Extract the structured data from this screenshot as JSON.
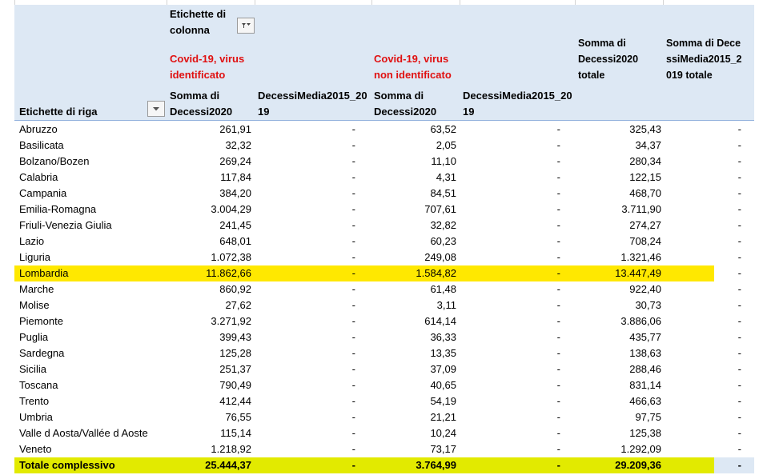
{
  "header": {
    "col_labels": "Etichette di colonna",
    "row_labels": "Etichette di riga",
    "group1": "Covid-19, virus identificato",
    "group2": "Covid-19, virus non identificato",
    "sum2020": "Somma di Decessi2020",
    "media": "DecessiMedia2015_2019",
    "total_sum": "Somma di Decessi2020 totale",
    "total_media": "Somma di DecessiMedia2015_2019 totale"
  },
  "rows": [
    {
      "name": "Abruzzo",
      "v1": "261,91",
      "m1": "-",
      "v2": "63,52",
      "m2": "-",
      "t": "325,43",
      "tm": "-"
    },
    {
      "name": "Basilicata",
      "v1": "32,32",
      "m1": "-",
      "v2": "2,05",
      "m2": "-",
      "t": "34,37",
      "tm": "-"
    },
    {
      "name": "Bolzano/Bozen",
      "v1": "269,24",
      "m1": "-",
      "v2": "11,10",
      "m2": "-",
      "t": "280,34",
      "tm": "-"
    },
    {
      "name": "Calabria",
      "v1": "117,84",
      "m1": "-",
      "v2": "4,31",
      "m2": "-",
      "t": "122,15",
      "tm": "-"
    },
    {
      "name": "Campania",
      "v1": "384,20",
      "m1": "-",
      "v2": "84,51",
      "m2": "-",
      "t": "468,70",
      "tm": "-"
    },
    {
      "name": "Emilia-Romagna",
      "v1": "3.004,29",
      "m1": "-",
      "v2": "707,61",
      "m2": "-",
      "t": "3.711,90",
      "tm": "-"
    },
    {
      "name": "Friuli-Venezia Giulia",
      "v1": "241,45",
      "m1": "-",
      "v2": "32,82",
      "m2": "-",
      "t": "274,27",
      "tm": "-"
    },
    {
      "name": "Lazio",
      "v1": "648,01",
      "m1": "-",
      "v2": "60,23",
      "m2": "-",
      "t": "708,24",
      "tm": "-"
    },
    {
      "name": "Liguria",
      "v1": "1.072,38",
      "m1": "-",
      "v2": "249,08",
      "m2": "-",
      "t": "1.321,46",
      "tm": "-"
    },
    {
      "name": "Lombardia",
      "v1": "11.862,66",
      "m1": "-",
      "v2": "1.584,82",
      "m2": "-",
      "t": "13.447,49",
      "tm": "-",
      "highlight": true
    },
    {
      "name": "Marche",
      "v1": "860,92",
      "m1": "-",
      "v2": "61,48",
      "m2": "-",
      "t": "922,40",
      "tm": "-"
    },
    {
      "name": "Molise",
      "v1": "27,62",
      "m1": "-",
      "v2": "3,11",
      "m2": "-",
      "t": "30,73",
      "tm": "-"
    },
    {
      "name": "Piemonte",
      "v1": "3.271,92",
      "m1": "-",
      "v2": "614,14",
      "m2": "-",
      "t": "3.886,06",
      "tm": "-"
    },
    {
      "name": "Puglia",
      "v1": "399,43",
      "m1": "-",
      "v2": "36,33",
      "m2": "-",
      "t": "435,77",
      "tm": "-"
    },
    {
      "name": "Sardegna",
      "v1": "125,28",
      "m1": "-",
      "v2": "13,35",
      "m2": "-",
      "t": "138,63",
      "tm": "-"
    },
    {
      "name": "Sicilia",
      "v1": "251,37",
      "m1": "-",
      "v2": "37,09",
      "m2": "-",
      "t": "288,46",
      "tm": "-"
    },
    {
      "name": "Toscana",
      "v1": "790,49",
      "m1": "-",
      "v2": "40,65",
      "m2": "-",
      "t": "831,14",
      "tm": "-"
    },
    {
      "name": "Trento",
      "v1": "412,44",
      "m1": "-",
      "v2": "54,19",
      "m2": "-",
      "t": "466,63",
      "tm": "-"
    },
    {
      "name": "Umbria",
      "v1": "76,55",
      "m1": "-",
      "v2": "21,21",
      "m2": "-",
      "t": "97,75",
      "tm": "-"
    },
    {
      "name": "Valle d Aosta/Vallée d Aoste",
      "v1": "115,14",
      "m1": "-",
      "v2": "10,24",
      "m2": "-",
      "t": "125,38",
      "tm": "-"
    },
    {
      "name": "Veneto",
      "v1": "1.218,92",
      "m1": "-",
      "v2": "73,17",
      "m2": "-",
      "t": "1.292,09",
      "tm": "-"
    }
  ],
  "total": {
    "name": "Totale complessivo",
    "v1": "25.444,37",
    "m1": "-",
    "v2": "3.764,99",
    "m2": "-",
    "t": "29.209,36",
    "tm": "-"
  },
  "colors": {
    "header_bg": "#dde8f4",
    "highlight": "#ffe800",
    "total_highlight": "#e2ea00",
    "accent_red": "#e01010"
  },
  "icons": {
    "column_filter": "filter-dropdown-icon",
    "row_filter": "chevron-down-icon"
  }
}
